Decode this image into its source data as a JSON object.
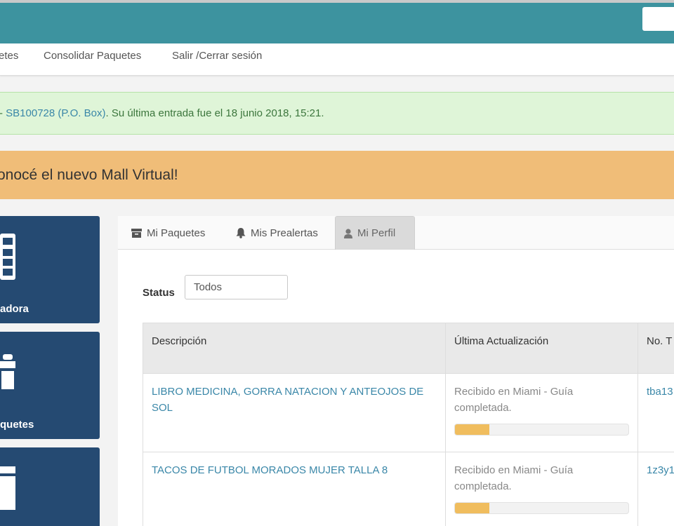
{
  "nav": {
    "items": [
      "etes",
      "Consolidar Paquetes",
      "Salir /Cerrar sesión"
    ]
  },
  "alert": {
    "prefix": "- ",
    "link": "SB100728 (P.O. Box)",
    "message": ". Su última entrada fue el 18 junio 2018, 15:21."
  },
  "banner": {
    "text": "onocé el nuevo Mall Virtual!"
  },
  "tiles": [
    {
      "label": "adora",
      "icon": "calculator-icon"
    },
    {
      "label": "quetes",
      "icon": "gift-icon"
    },
    {
      "label": "",
      "icon": "box-icon"
    }
  ],
  "tabs": [
    {
      "label": "Mi Paquetes",
      "icon": "archive-icon"
    },
    {
      "label": "Mis Prealertas",
      "icon": "bell-icon"
    },
    {
      "label": "Mi Perfil",
      "icon": "user-icon",
      "active": true
    }
  ],
  "filter": {
    "label": "Status",
    "value": "Todos"
  },
  "table": {
    "headers": [
      "Descripción",
      "Última Actualización",
      "No. T"
    ],
    "rows": [
      {
        "description": "LIBRO MEDICINA, GORRA NATACION Y ANTEOJOS DE SOL",
        "update": "Recibido en Miami - Guía completada.",
        "progress": 0.2,
        "tracking": "tba13"
      },
      {
        "description": "TACOS DE FUTBOL MORADOS MUJER TALLA 8",
        "update": "Recibido en Miami - Guía completada.",
        "progress": 0.2,
        "tracking": "1z3y1"
      }
    ]
  },
  "colors": {
    "header": "#3d939f",
    "tile": "#254a72",
    "banner": "#f0bd78",
    "alert_bg": "#dff5d8",
    "link": "#3a87a8",
    "progress": "#f0bd5e"
  }
}
